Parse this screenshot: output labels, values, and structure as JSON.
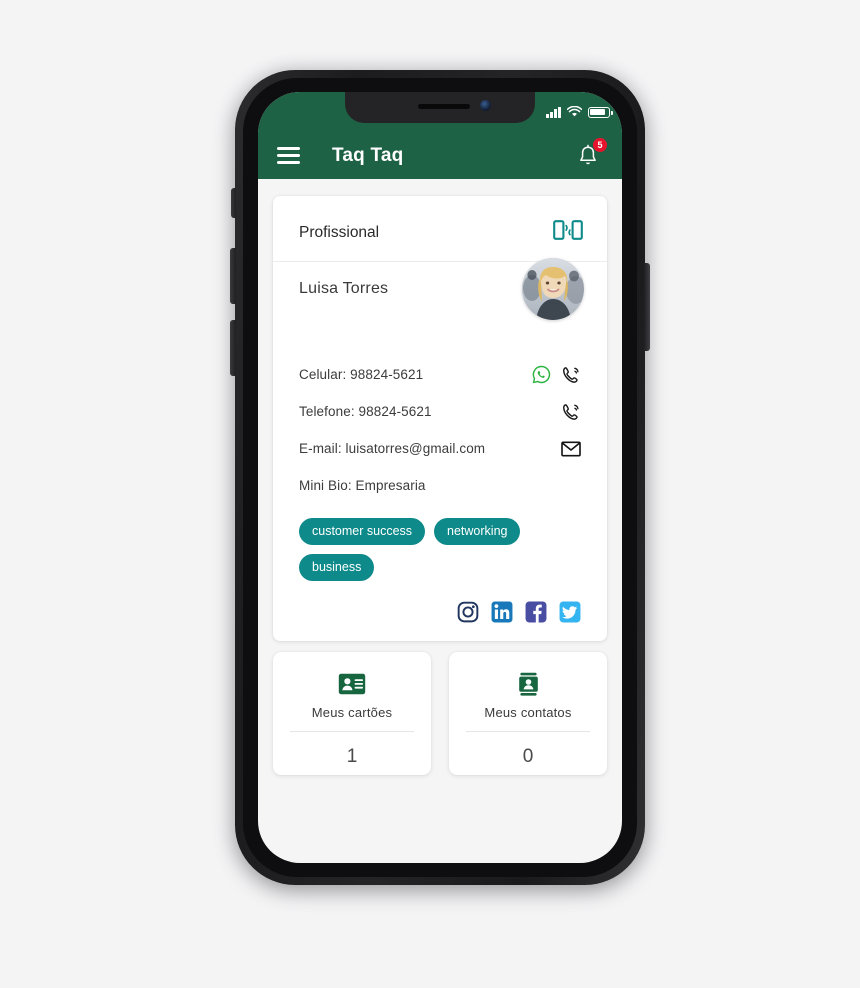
{
  "theme": {
    "header_green": "#1e6246",
    "tag_teal": "#0e8a8a",
    "badge_red": "#e8142d",
    "page_background": "#f4f4f5",
    "screen_background": "#f5f5f5",
    "card_white": "#ffffff"
  },
  "statusbar": {
    "signal_icon": "cellular-signal-icon",
    "wifi_icon": "wifi-icon",
    "battery_icon": "battery-icon"
  },
  "header": {
    "menu_icon": "hamburger-menu-icon",
    "title": "Taq Taq",
    "notification_icon": "bell-icon",
    "notification_count": "5"
  },
  "profile_card": {
    "section_title": "Profissional",
    "share_icon": "nfc-share-devices-icon",
    "name": "Luisa Torres",
    "avatar": "user-avatar",
    "contacts": [
      {
        "label": "Celular: 98824-5621",
        "icons": [
          "whatsapp-icon",
          "phone-call-icon"
        ]
      },
      {
        "label": "Telefone: 98824-5621",
        "icons": [
          "phone-call-icon"
        ]
      },
      {
        "label": "E-mail: luisatorres@gmail.com",
        "icons": [
          "email-envelope-icon"
        ]
      },
      {
        "label": "Mini Bio: Empresaria",
        "icons": []
      }
    ],
    "tags": [
      "customer success",
      "networking",
      "business"
    ],
    "socials": [
      {
        "name": "instagram-icon",
        "color": "#1f3a63"
      },
      {
        "name": "linkedin-icon",
        "color": "#1878b9"
      },
      {
        "name": "facebook-icon",
        "color": "#4a4ea3"
      },
      {
        "name": "twitter-icon",
        "color": "#34b4f0"
      }
    ]
  },
  "stats": [
    {
      "icon": "contact-card-icon",
      "label": "Meus cartões",
      "value": "1"
    },
    {
      "icon": "contacts-book-icon",
      "label": "Meus contatos",
      "value": "0"
    }
  ]
}
